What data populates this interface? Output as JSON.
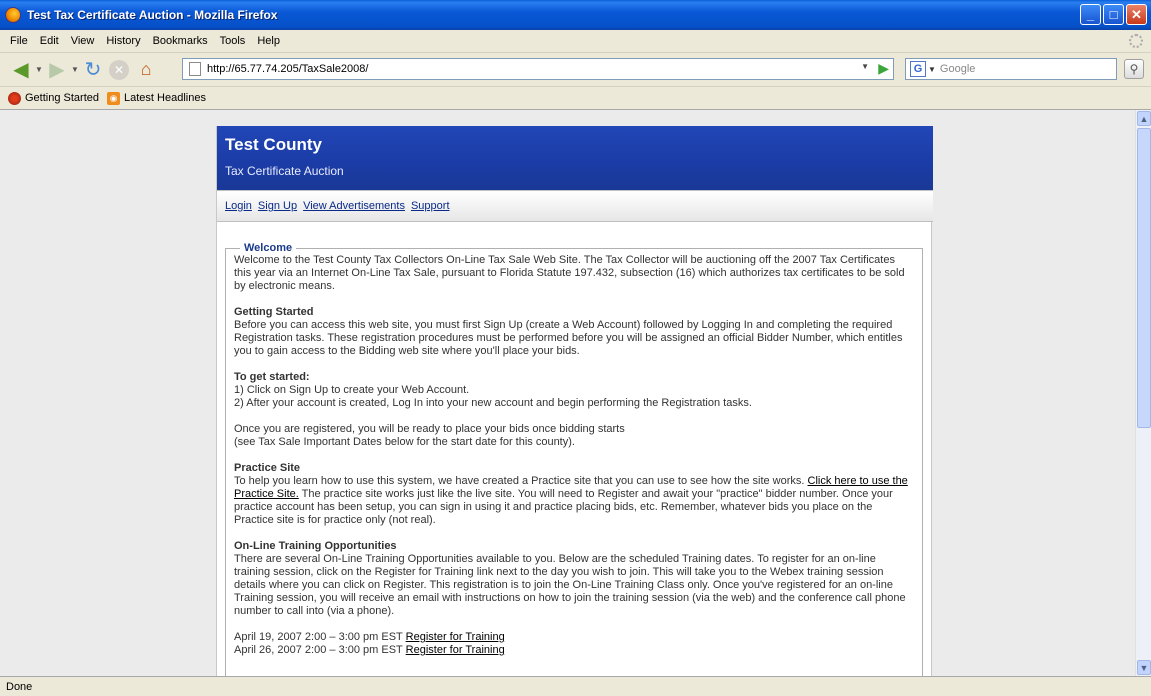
{
  "window": {
    "title": "Test Tax Certificate Auction - Mozilla Firefox"
  },
  "menu": [
    "File",
    "Edit",
    "View",
    "History",
    "Bookmarks",
    "Tools",
    "Help"
  ],
  "nav": {
    "url": "http://65.77.74.205/TaxSale2008/",
    "search_placeholder": "Google"
  },
  "bookmarks": [
    "Getting Started",
    "Latest Headlines"
  ],
  "page": {
    "county": "Test County",
    "subtitle": "Tax Certificate Auction",
    "links": [
      "Login",
      "Sign Up",
      "View Advertisements",
      "Support"
    ],
    "legend": "Welcome",
    "intro": "Welcome to the Test County Tax Collectors On-Line Tax Sale Web Site. The Tax Collector will be auctioning off the 2007 Tax Certificates this year via an Internet On-Line Tax Sale, pursuant to Florida Statute 197.432, subsection (16) which authorizes tax certificates to be sold by electronic means.",
    "getting_started_heading": "Getting Started",
    "getting_started_text": "Before you can access this web site, you must first Sign Up (create a Web Account) followed by Logging In and completing the required Registration tasks. These registration procedures must be performed before you will be assigned an official Bidder Number, which entitles you to gain access to the Bidding web site where you'll place your bids.",
    "to_get_started_heading": "To get started:",
    "step1": "1) Click on Sign Up to create your Web Account.",
    "step2": "2) After your account is created, Log In into your new account and begin performing the Registration tasks.",
    "registered_line1": "Once you are registered, you will be ready to place your bids once bidding starts",
    "registered_line2": "(see Tax Sale Important Dates below for the start date for this county).",
    "practice_heading": "Practice Site",
    "practice_pre": "To help you learn how to use this system, we have created a Practice site that you can use to see how the site works. ",
    "practice_link": "Click here to use the Practice Site.",
    "practice_post": " The practice site works just like the live site. You will need to Register and await your \"practice\" bidder number. Once your practice account has been setup, you can sign in using it and practice placing bids, etc. Remember, whatever bids you place on the Practice site is for practice only (not real).",
    "training_heading": "On-Line Training Opportunities",
    "training_text": "There are several On-Line Training Opportunities available to you. Below are the scheduled Training dates. To register for an on-line training session, click on the Register for Training link next to the day you wish to join. This will take you to the Webex training session details where you can click on Register. This registration is to join the On-Line Training Class only. Once you've registered for an on-line Training session, you will receive an email with instructions on how to join the training session (via the web) and the conference call phone number to call into (via a phone).",
    "sessions": [
      {
        "date": "April 19, 2007 2:00 – 3:00 pm EST ",
        "link": "Register for Training"
      },
      {
        "date": "April 26, 2007 2:00 – 3:00 pm EST ",
        "link": "Register for Training"
      }
    ]
  },
  "status": {
    "text": "Done"
  }
}
